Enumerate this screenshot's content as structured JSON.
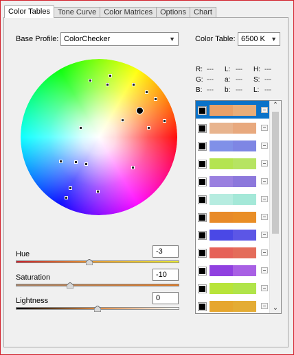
{
  "tabs": [
    {
      "label": "Color Tables",
      "active": true
    },
    {
      "label": "Tone Curve",
      "active": false
    },
    {
      "label": "Color Matrices",
      "active": false
    },
    {
      "label": "Options",
      "active": false
    },
    {
      "label": "Chart",
      "active": false
    }
  ],
  "base_profile": {
    "label": "Base Profile:",
    "value": "ColorChecker"
  },
  "color_table": {
    "label": "Color Table:",
    "value": "6500 K"
  },
  "readouts": {
    "R": "---",
    "L": "---",
    "H": "---",
    "G": "---",
    "a": "---",
    "S": "---",
    "B": "---",
    "b": "---",
    "L2": "---"
  },
  "readout_labels": {
    "R": "R:",
    "L": "L:",
    "H": "H:",
    "G": "G:",
    "a": "a:",
    "S": "S:",
    "B": "B:",
    "b": "b:",
    "L2": "L:"
  },
  "sliders": [
    {
      "label": "Hue",
      "value": "-3",
      "position": 0.46
    },
    {
      "label": "Saturation",
      "value": "-10",
      "position": 0.33
    },
    {
      "label": "Lightness",
      "value": "0",
      "position": 0.5
    }
  ],
  "swatches": [
    {
      "left": "#e8a068",
      "right": "#e9ad78",
      "selected": true
    },
    {
      "left": "#e8b48e",
      "right": "#e8a97e",
      "selected": false
    },
    {
      "left": "#8090e8",
      "right": "#7e86e4",
      "selected": false
    },
    {
      "left": "#b4e450",
      "right": "#b6e462",
      "selected": false
    },
    {
      "left": "#9a80e0",
      "right": "#8c78dc",
      "selected": false
    },
    {
      "left": "#b6ece0",
      "right": "#a4e8d8",
      "selected": false
    },
    {
      "left": "#e88a28",
      "right": "#e98e26",
      "selected": false
    },
    {
      "left": "#4a48e6",
      "right": "#5c56e6",
      "selected": false
    },
    {
      "left": "#e66258",
      "right": "#e46c5a",
      "selected": false
    },
    {
      "left": "#9040e0",
      "right": "#a860e4",
      "selected": false
    },
    {
      "left": "#b8e43a",
      "right": "#b0e44a",
      "selected": false
    },
    {
      "left": "#e6a62e",
      "right": "#e4ac34",
      "selected": false
    }
  ],
  "icons": {
    "dropdown": "chevron-down-icon",
    "scroll_up": "chevron-up-icon",
    "scroll_down": "chevron-down-icon"
  }
}
